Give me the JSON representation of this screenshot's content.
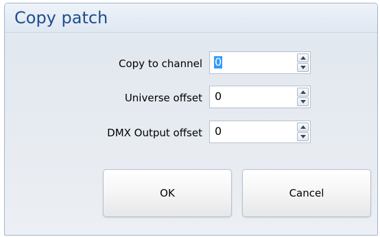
{
  "dialog": {
    "title": "Copy patch"
  },
  "fields": [
    {
      "label": "Copy to channel",
      "value": "0"
    },
    {
      "label": "Universe offset",
      "value": "0"
    },
    {
      "label": "DMX Output offset",
      "value": "0"
    }
  ],
  "buttons": {
    "ok_label": "OK",
    "cancel_label": "Cancel"
  },
  "colors": {
    "title_text": "#1f4e8c",
    "selection": "#3399ff"
  },
  "icons": {
    "spin_up": "triangle-up-icon",
    "spin_down": "triangle-down-icon"
  }
}
